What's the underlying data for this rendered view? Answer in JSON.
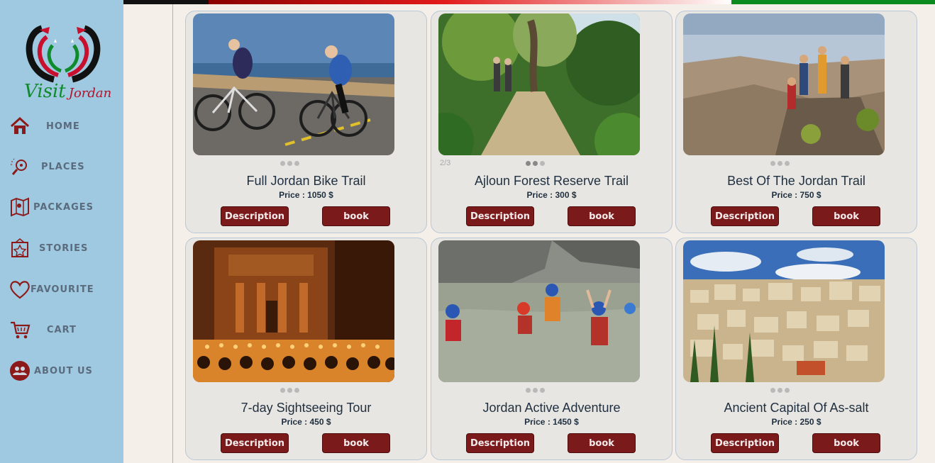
{
  "brand": {
    "visit": "Visit",
    "jordan": "Jordan"
  },
  "nav": [
    {
      "label": "HOME",
      "icon": "home-icon"
    },
    {
      "label": "PLACES",
      "icon": "places-icon"
    },
    {
      "label": "PACKAGES",
      "icon": "map-icon"
    },
    {
      "label": "STORIES",
      "icon": "star-frame-icon"
    },
    {
      "label": "FAVOURITE",
      "icon": "heart-icon"
    },
    {
      "label": "CART",
      "icon": "cart-icon"
    },
    {
      "label": "ABOUT US",
      "icon": "people-icon"
    }
  ],
  "colors": {
    "sidebar": "#9fc9e0",
    "button": "#7a1a1a",
    "accent_green": "#0b8a1e",
    "accent_red": "#e21a1a"
  },
  "packages": [
    {
      "title": "Full Jordan Bike Trail",
      "price": "Price : 1050 $",
      "desc_label": "Description",
      "book_label": "book",
      "image": "cyclists on coastal road"
    },
    {
      "title": "Ajloun Forest Reserve Trail",
      "price": "Price : 300 $",
      "desc_label": "Description",
      "book_label": "book",
      "counter": "2/3",
      "image": "hikers on forest path"
    },
    {
      "title": "Best Of The Jordan Trail",
      "price": "Price : 750 $",
      "desc_label": "Description",
      "book_label": "book",
      "image": "hikers on desert mountain peak"
    },
    {
      "title": "7-day Sightseeing Tour",
      "price": "Price : 450 $",
      "desc_label": "Description",
      "book_label": "book",
      "image": "Petra treasury by candlelight"
    },
    {
      "title": "Jordan Active Adventure",
      "price": "Price : 1450 $",
      "desc_label": "Description",
      "book_label": "book",
      "image": "group wading through canyon river"
    },
    {
      "title": "Ancient Capital Of As-salt",
      "price": "Price : 250 $",
      "desc_label": "Description",
      "book_label": "book",
      "image": "hillside city of As-salt"
    }
  ]
}
